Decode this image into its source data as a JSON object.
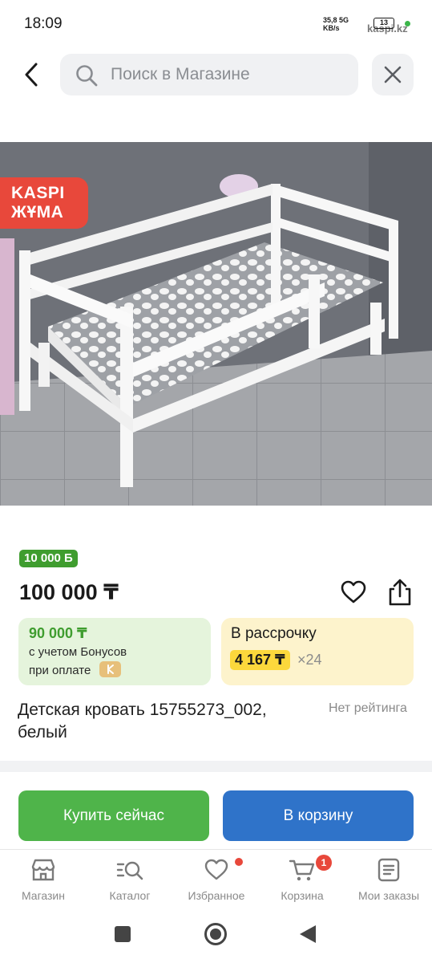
{
  "status_bar": {
    "time": "18:09",
    "speed_value": "35,8 5G",
    "speed_unit": "KB/s",
    "battery": "13",
    "host": "kaspi.kz"
  },
  "search": {
    "placeholder": "Поиск в Магазине"
  },
  "product": {
    "promo_badge_line1": "KASPI",
    "promo_badge_line2": "ЖҰМА",
    "bonus_badge": "10 000 Б",
    "price": "100 000 ₸",
    "bonus_card": {
      "amount": "90 000 ₸",
      "line1": "с учетом Бонусов",
      "line2": "при оплате"
    },
    "installment_card": {
      "title": "В рассрочку",
      "monthly": "4 167 ₸",
      "months": "×24"
    },
    "title": "Детская кровать 15755273_002, белый",
    "rating": "Нет рейтинга"
  },
  "actions": {
    "buy_now": "Купить сейчас",
    "add_to_cart": "В корзину"
  },
  "bottom_nav": {
    "items": [
      {
        "label": "Магазин",
        "icon": "store-icon"
      },
      {
        "label": "Каталог",
        "icon": "catalog-search-icon"
      },
      {
        "label": "Избранное",
        "icon": "heart-icon"
      },
      {
        "label": "Корзина",
        "icon": "cart-icon",
        "badge": "1"
      },
      {
        "label": "Мои заказы",
        "icon": "orders-icon"
      }
    ]
  },
  "colors": {
    "kaspi_red": "#e8483b",
    "bonus_green": "#3f9d2f",
    "buy_green": "#4fb44a",
    "cart_blue": "#2f73c9",
    "installment_yellow": "#fcd83c"
  }
}
